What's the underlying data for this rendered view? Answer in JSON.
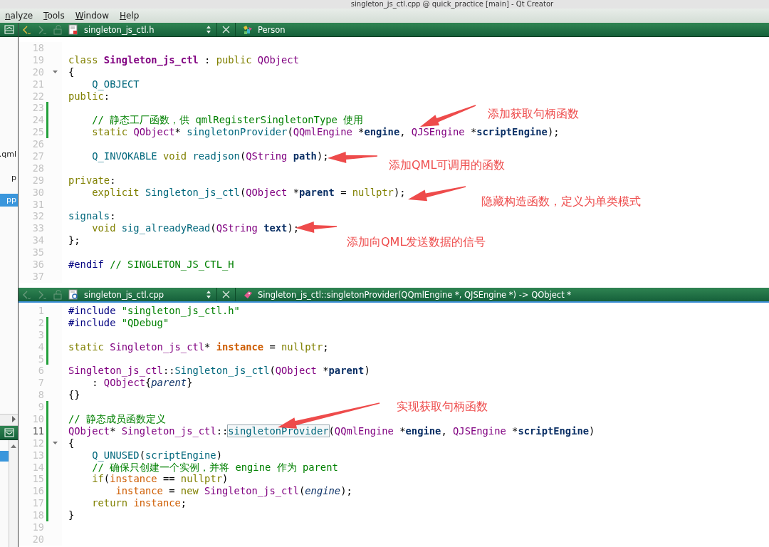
{
  "window": {
    "title": "singleton_js_ctl.cpp @ quick_practice [main] - Qt Creator"
  },
  "menu": [
    {
      "label": "nalyze"
    },
    {
      "label": "Tools"
    },
    {
      "label": "Window"
    },
    {
      "label": "Help"
    }
  ],
  "sidebar": {
    "items": [
      {
        "label": ".qml",
        "selected": false
      },
      {
        "label": "p",
        "selected": false
      },
      {
        "label": "pp",
        "selected": true
      }
    ],
    "lower_items": [
      {
        "selected": true
      }
    ]
  },
  "editors": [
    {
      "file": {
        "name": "singleton_js_ctl.h",
        "kind": "header"
      },
      "symbol": {
        "name": "Person",
        "kind": "class"
      },
      "focused": false,
      "back_disabled": false,
      "forward_disabled": true,
      "lines": [
        {
          "number": "18",
          "changed": false,
          "foldable": false,
          "current": false
        },
        {
          "number": "19",
          "tokens": [
            {
              "text": "class",
              "kind": "keyword"
            },
            {
              "text": " Singleton_js_ctl",
              "kind": "classname"
            },
            {
              "text": " : ",
              "kind": "plain"
            },
            {
              "text": "public",
              "kind": "keyword"
            },
            {
              "text": " QObject",
              "kind": "type"
            }
          ],
          "changed": false,
          "foldable": false,
          "current": false
        },
        {
          "number": "20",
          "tokens": [
            {
              "text": "{",
              "kind": "plain"
            }
          ],
          "changed": false,
          "foldable": true,
          "current": false
        },
        {
          "number": "21",
          "tokens": [
            {
              "text": "    Q_OBJECT",
              "kind": "macro"
            }
          ],
          "changed": false,
          "foldable": false,
          "current": false
        },
        {
          "number": "22",
          "tokens": [
            {
              "text": "public",
              "kind": "keyword"
            },
            {
              "text": ":",
              "kind": "plain"
            }
          ],
          "changed": false,
          "foldable": false,
          "current": false
        },
        {
          "number": "23",
          "changed": true,
          "foldable": false,
          "current": false
        },
        {
          "number": "24",
          "tokens": [
            {
              "text": "    // 静态工厂函数，供 qmlRegisterSingletonType 使用",
              "kind": "comment"
            }
          ],
          "changed": true,
          "foldable": false,
          "current": false
        },
        {
          "number": "25",
          "tokens": [
            {
              "text": "    static",
              "kind": "keyword"
            },
            {
              "text": " QObject",
              "kind": "type"
            },
            {
              "text": "* ",
              "kind": "plain"
            },
            {
              "text": "singletonProvider",
              "kind": "function"
            },
            {
              "text": "(",
              "kind": "plain"
            },
            {
              "text": "QQmlEngine",
              "kind": "type"
            },
            {
              "text": " *",
              "kind": "plain"
            },
            {
              "text": "engine",
              "kind": "parameter"
            },
            {
              "text": ", ",
              "kind": "plain"
            },
            {
              "text": "QJSEngine",
              "kind": "type"
            },
            {
              "text": " *",
              "kind": "plain"
            },
            {
              "text": "scriptEngine",
              "kind": "parameter"
            },
            {
              "text": ");",
              "kind": "plain"
            }
          ],
          "changed": true,
          "foldable": false,
          "current": false
        },
        {
          "number": "26",
          "changed": false,
          "foldable": false,
          "current": false
        },
        {
          "number": "27",
          "tokens": [
            {
              "text": "    Q_INVOKABLE",
              "kind": "macro"
            },
            {
              "text": " void",
              "kind": "keyword"
            },
            {
              "text": " readjson",
              "kind": "function"
            },
            {
              "text": "(",
              "kind": "plain"
            },
            {
              "text": "QString",
              "kind": "type"
            },
            {
              "text": " path",
              "kind": "parameter"
            },
            {
              "text": ");",
              "kind": "plain"
            }
          ],
          "changed": false,
          "foldable": false,
          "current": false
        },
        {
          "number": "28",
          "changed": false,
          "foldable": false,
          "current": false
        },
        {
          "number": "29",
          "tokens": [
            {
              "text": "private",
              "kind": "keyword"
            },
            {
              "text": ":",
              "kind": "plain"
            }
          ],
          "changed": false,
          "foldable": false,
          "current": false
        },
        {
          "number": "30",
          "tokens": [
            {
              "text": "    explicit",
              "kind": "keyword"
            },
            {
              "text": " Singleton_js_ctl",
              "kind": "function"
            },
            {
              "text": "(",
              "kind": "plain"
            },
            {
              "text": "QObject",
              "kind": "type"
            },
            {
              "text": " *",
              "kind": "plain"
            },
            {
              "text": "parent",
              "kind": "parameter"
            },
            {
              "text": " = ",
              "kind": "plain"
            },
            {
              "text": "nullptr",
              "kind": "keyword"
            },
            {
              "text": ");",
              "kind": "plain"
            }
          ],
          "changed": false,
          "foldable": false,
          "current": false
        },
        {
          "number": "31",
          "changed": false,
          "foldable": false,
          "current": false
        },
        {
          "number": "32",
          "tokens": [
            {
              "text": "signals",
              "kind": "macro"
            },
            {
              "text": ":",
              "kind": "plain"
            }
          ],
          "changed": false,
          "foldable": false,
          "current": false
        },
        {
          "number": "33",
          "tokens": [
            {
              "text": "    void",
              "kind": "keyword"
            },
            {
              "text": " sig_alreadyRead",
              "kind": "function"
            },
            {
              "text": "(",
              "kind": "plain"
            },
            {
              "text": "QString",
              "kind": "type"
            },
            {
              "text": " text",
              "kind": "parameter"
            },
            {
              "text": ");",
              "kind": "plain"
            }
          ],
          "changed": false,
          "foldable": false,
          "current": false
        },
        {
          "number": "34",
          "tokens": [
            {
              "text": "};",
              "kind": "plain"
            }
          ],
          "changed": false,
          "foldable": false,
          "current": false
        },
        {
          "number": "35",
          "changed": false,
          "foldable": false,
          "current": false
        },
        {
          "number": "36",
          "tokens": [
            {
              "text": "#endif",
              "kind": "directive"
            },
            {
              "text": " // SINGLETON_JS_CTL_H",
              "kind": "comment"
            }
          ],
          "changed": false,
          "foldable": false,
          "current": false
        },
        {
          "number": "37",
          "changed": false,
          "foldable": false,
          "current": false
        }
      ],
      "annotations": [
        {
          "text": "添加获取句柄函数"
        },
        {
          "text": "添加QML可调用的函数"
        },
        {
          "text": "隐藏构造函数，定义为单类模式"
        },
        {
          "text": "添加向QML发送数据的信号"
        }
      ]
    },
    {
      "file": {
        "name": "singleton_js_ctl.cpp",
        "kind": "source"
      },
      "symbol": {
        "name": "Singleton_js_ctl::singletonProvider(QQmlEngine *, QJSEngine *) -> QObject *",
        "kind": "function"
      },
      "focused": true,
      "back_disabled": true,
      "forward_disabled": true,
      "lines": [
        {
          "number": "1",
          "tokens": [
            {
              "text": "#include",
              "kind": "directive"
            },
            {
              "text": " \"singleton_js_ctl.h\"",
              "kind": "string"
            }
          ],
          "changed": false,
          "foldable": false,
          "current": false
        },
        {
          "number": "2",
          "tokens": [
            {
              "text": "#include",
              "kind": "directive"
            },
            {
              "text": " \"QDebug\"",
              "kind": "string"
            }
          ],
          "changed": true,
          "foldable": false,
          "current": false
        },
        {
          "number": "3",
          "changed": true,
          "foldable": false,
          "current": false
        },
        {
          "number": "4",
          "tokens": [
            {
              "text": "static",
              "kind": "keyword"
            },
            {
              "text": " Singleton_js_ctl",
              "kind": "type"
            },
            {
              "text": "* ",
              "kind": "plain"
            },
            {
              "text": "instance",
              "kind": "declaration"
            },
            {
              "text": " = ",
              "kind": "plain"
            },
            {
              "text": "nullptr",
              "kind": "keyword"
            },
            {
              "text": ";",
              "kind": "plain"
            }
          ],
          "changed": true,
          "foldable": false,
          "current": false
        },
        {
          "number": "5",
          "changed": true,
          "foldable": false,
          "current": false
        },
        {
          "number": "6",
          "tokens": [
            {
              "text": "Singleton_js_ctl",
              "kind": "type"
            },
            {
              "text": "::",
              "kind": "plain"
            },
            {
              "text": "Singleton_js_ctl",
              "kind": "function"
            },
            {
              "text": "(",
              "kind": "plain"
            },
            {
              "text": "QObject",
              "kind": "type"
            },
            {
              "text": " *",
              "kind": "plain"
            },
            {
              "text": "parent",
              "kind": "parameter"
            },
            {
              "text": ")",
              "kind": "plain"
            }
          ],
          "changed": false,
          "foldable": false,
          "current": false
        },
        {
          "number": "7",
          "tokens": [
            {
              "text": "    : ",
              "kind": "plain"
            },
            {
              "text": "QObject",
              "kind": "type"
            },
            {
              "text": "{",
              "kind": "plain"
            },
            {
              "text": "parent",
              "kind": "argument"
            },
            {
              "text": "}",
              "kind": "plain"
            }
          ],
          "changed": false,
          "foldable": false,
          "current": false
        },
        {
          "number": "8",
          "tokens": [
            {
              "text": "{}",
              "kind": "plain"
            }
          ],
          "changed": false,
          "foldable": false,
          "current": false
        },
        {
          "number": "9",
          "changed": true,
          "foldable": false,
          "current": false
        },
        {
          "number": "10",
          "tokens": [
            {
              "text": "// 静态成员函数定义",
              "kind": "comment"
            }
          ],
          "changed": true,
          "foldable": false,
          "current": false
        },
        {
          "number": "11",
          "tokens": [
            {
              "text": "QObject",
              "kind": "type"
            },
            {
              "text": "* ",
              "kind": "plain"
            },
            {
              "text": "Singleton_js_ctl",
              "kind": "type"
            },
            {
              "text": "::",
              "kind": "plain"
            },
            {
              "text": "singletonProvider",
              "kind": "match"
            },
            {
              "text": "(",
              "kind": "plain"
            },
            {
              "text": "QQmlEngine",
              "kind": "type"
            },
            {
              "text": " *",
              "kind": "plain"
            },
            {
              "text": "engine",
              "kind": "parameter"
            },
            {
              "text": ", ",
              "kind": "plain"
            },
            {
              "text": "QJSEngine",
              "kind": "type"
            },
            {
              "text": " *",
              "kind": "plain"
            },
            {
              "text": "scriptEngine",
              "kind": "parameter"
            },
            {
              "text": ")",
              "kind": "plain"
            }
          ],
          "changed": true,
          "foldable": false,
          "current": true
        },
        {
          "number": "12",
          "tokens": [
            {
              "text": "{",
              "kind": "plain"
            }
          ],
          "changed": true,
          "foldable": true,
          "current": false
        },
        {
          "number": "13",
          "tokens": [
            {
              "text": "    Q_UNUSED",
              "kind": "macro"
            },
            {
              "text": "(",
              "kind": "plain"
            },
            {
              "text": "scriptEngine",
              "kind": "function"
            },
            {
              "text": ")",
              "kind": "plain"
            }
          ],
          "changed": true,
          "foldable": false,
          "current": false
        },
        {
          "number": "14",
          "tokens": [
            {
              "text": "    // 确保只创建一个实例，并将 engine 作为 parent",
              "kind": "comment"
            }
          ],
          "changed": true,
          "foldable": false,
          "current": false
        },
        {
          "number": "15",
          "tokens": [
            {
              "text": "    if",
              "kind": "keyword"
            },
            {
              "text": "(",
              "kind": "plain"
            },
            {
              "text": "instance",
              "kind": "variable"
            },
            {
              "text": " == ",
              "kind": "plain"
            },
            {
              "text": "nullptr",
              "kind": "keyword"
            },
            {
              "text": ")",
              "kind": "plain"
            }
          ],
          "changed": true,
          "foldable": false,
          "current": false
        },
        {
          "number": "16",
          "tokens": [
            {
              "text": "        instance",
              "kind": "variable"
            },
            {
              "text": " = ",
              "kind": "plain"
            },
            {
              "text": "new",
              "kind": "keyword"
            },
            {
              "text": " Singleton_js_ctl",
              "kind": "type"
            },
            {
              "text": "(",
              "kind": "plain"
            },
            {
              "text": "engine",
              "kind": "argument"
            },
            {
              "text": ");",
              "kind": "plain"
            }
          ],
          "changed": true,
          "foldable": false,
          "current": false
        },
        {
          "number": "17",
          "tokens": [
            {
              "text": "    return",
              "kind": "keyword"
            },
            {
              "text": " instance",
              "kind": "variable"
            },
            {
              "text": ";",
              "kind": "plain"
            }
          ],
          "changed": true,
          "foldable": false,
          "current": false
        },
        {
          "number": "18",
          "tokens": [
            {
              "text": "}",
              "kind": "plain"
            }
          ],
          "changed": true,
          "foldable": false,
          "current": false
        },
        {
          "number": "19",
          "changed": false,
          "foldable": false,
          "current": false
        },
        {
          "number": "20",
          "changed": false,
          "foldable": false,
          "current": false
        }
      ],
      "annotations": [
        {
          "text": "实现获取句柄函数"
        }
      ]
    }
  ]
}
